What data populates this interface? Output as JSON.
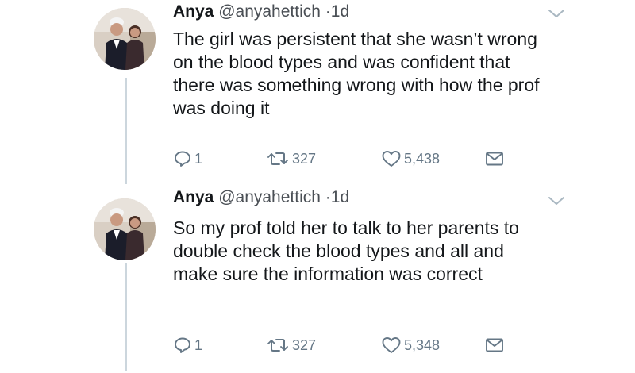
{
  "tweets": [
    {
      "name": "Anya",
      "handle": "@anyahettich",
      "separator": "·",
      "time": "1d",
      "text": "The girl was persistent that she wasn’t wrong on the blood types and was confident that there was something wrong with how the prof was doing it",
      "replies": "1",
      "retweets": "327",
      "likes": "5,438",
      "icons": {
        "reply": "reply-icon",
        "retweet": "retweet-icon",
        "like": "heart-icon",
        "dm": "envelope-icon",
        "menu": "chevron-down-icon"
      }
    },
    {
      "name": "Anya",
      "handle": "@anyahettich",
      "separator": "·",
      "time": "1d",
      "text": "So my prof told her to talk to her parents to double check the blood types and all and make sure the information was correct",
      "replies": "1",
      "retweets": "327",
      "likes": "5,348",
      "icons": {
        "reply": "reply-icon",
        "retweet": "retweet-icon",
        "like": "heart-icon",
        "dm": "envelope-icon",
        "menu": "chevron-down-icon"
      }
    }
  ],
  "colors": {
    "text": "#14171a",
    "muted": "#657786",
    "thread": "#ccd6dd"
  }
}
